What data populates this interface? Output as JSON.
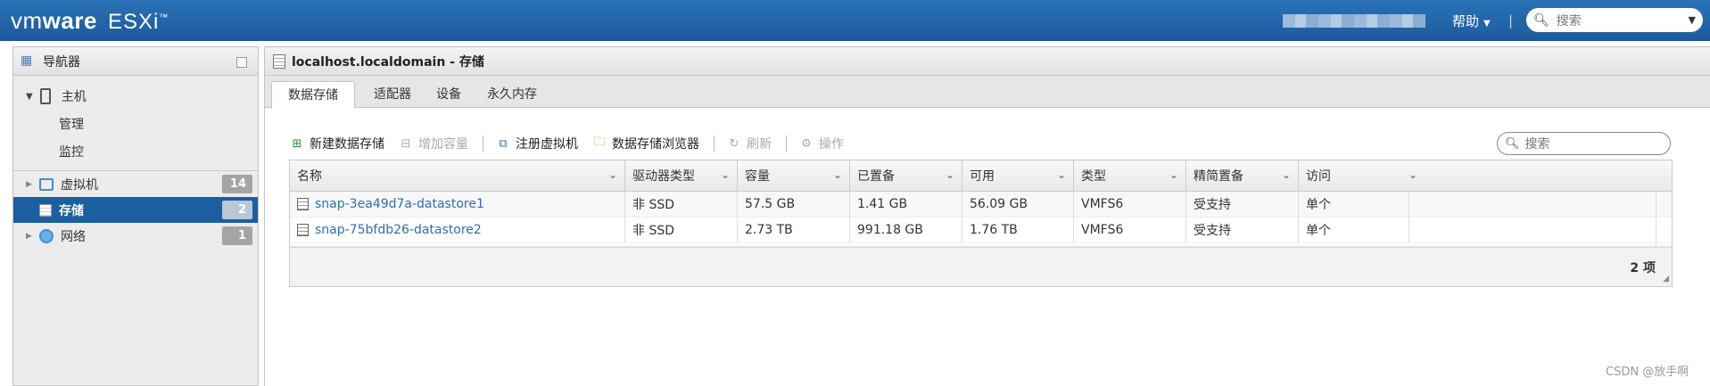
{
  "topbar": {
    "logo_vm": "vm",
    "logo_ware": "ware",
    "logo_product": "ESXi",
    "logo_tm": "™",
    "help_label": "帮助",
    "search_placeholder": "搜索"
  },
  "navigator": {
    "title": "导航器",
    "host": {
      "label": "主机",
      "children": [
        "管理",
        "监控"
      ]
    },
    "items": [
      {
        "label": "虚拟机",
        "badge": "14",
        "icon": "vm-icon"
      },
      {
        "label": "存储",
        "badge": "2",
        "icon": "storage-icon",
        "active": true
      },
      {
        "label": "网络",
        "badge": "1",
        "icon": "network-icon"
      }
    ]
  },
  "main": {
    "title": "localhost.localdomain - 存储",
    "tabs": [
      {
        "label": "数据存储",
        "active": true
      },
      {
        "label": "适配器"
      },
      {
        "label": "设备"
      },
      {
        "label": "永久内存"
      }
    ],
    "toolbar": {
      "new_datastore": "新建数据存储",
      "increase_capacity": "增加容量",
      "register_vm": "注册虚拟机",
      "datastore_browser": "数据存储浏览器",
      "refresh": "刷新",
      "actions": "操作"
    },
    "search_placeholder": "搜索",
    "table": {
      "columns": [
        "名称",
        "驱动器类型",
        "容量",
        "已置备",
        "可用",
        "类型",
        "精简置备",
        "访问"
      ],
      "rows": [
        [
          "snap-3ea49d7a-datastore1",
          "非 SSD",
          "57.5 GB",
          "1.41 GB",
          "56.09 GB",
          "VMFS6",
          "受支持",
          "单个"
        ],
        [
          "snap-75bfdb26-datastore2",
          "非 SSD",
          "2.73 TB",
          "991.18 GB",
          "1.76 TB",
          "VMFS6",
          "受支持",
          "单个"
        ]
      ],
      "count_label": "2 项"
    }
  },
  "watermark": "CSDN @放手啊",
  "colors": {
    "topbar": "#1d5a9c",
    "active_nav": "#1b5fa0",
    "link": "#2e6fb5"
  }
}
